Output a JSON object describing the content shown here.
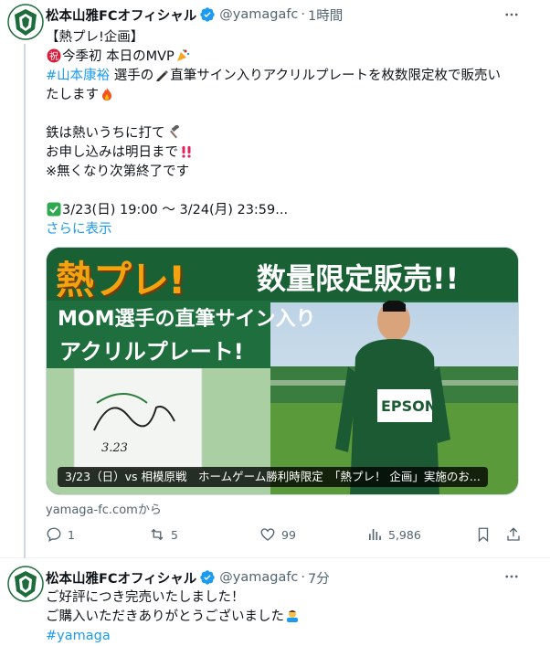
{
  "colors": {
    "accent": "#1d9bf0",
    "text": "#0f1419",
    "muted": "#536471",
    "brand_green": "#1e6b3c"
  },
  "tweet1": {
    "author_name": "松本山雅FCオフィシャル",
    "handle": "@yamagafc",
    "time": "1時間",
    "lines": {
      "l1": "【熱プレ!企画】",
      "l2": "今季初 本日のMVP",
      "l3_hashtag": "#山本康裕",
      "l3_text": "選手の",
      "l3_text2": "直筆サイン入りアクリルプレートを枚数限定枚で販売い",
      "l4": "たします",
      "l5": "鉄は熱いうちに打て",
      "l6": "お申し込みは明日まで",
      "l7": "※無くなり次第終了です",
      "l8": "3/23(日) 19:00 ～ 3/24(月) 23:59...",
      "show_more": "さらに表示"
    },
    "card": {
      "headline_big": "熱プレ!",
      "headline_right": "数量限定販売!!",
      "sub1": "MOM選手の直筆サイン入り",
      "sub2": "アクリルプレート!",
      "sign_text": "3.23",
      "jersey_text": "EPSON",
      "caption": "3/23（日）vs 相模原戦　ホームゲーム勝利時限定　「熱プレ！ 企画」実施のお...",
      "source": "yamaga-fc.comから"
    },
    "stats": {
      "replies": "1",
      "retweets": "5",
      "likes": "99",
      "views": "5,986"
    }
  },
  "tweet2": {
    "author_name": "松本山雅FCオフィシャル",
    "handle": "@yamagafc",
    "time": "7分",
    "line1": "ご好評につき完売いたしました！",
    "line2": "ご購入いただきありがとうございました",
    "hashtag": "#yamaga"
  },
  "icons": [
    "more-icon",
    "verified-icon",
    "reply-icon",
    "retweet-icon",
    "like-icon",
    "views-icon",
    "bookmark-icon",
    "share-icon"
  ]
}
